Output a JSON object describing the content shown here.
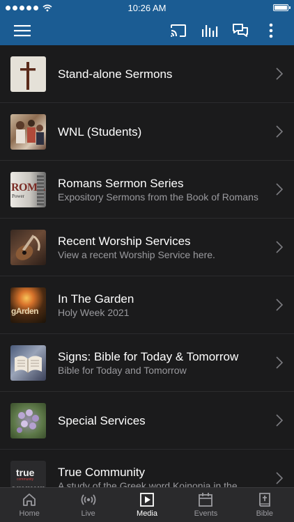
{
  "status_bar": {
    "time": "10:26 AM"
  },
  "app_bar": {
    "icons": [
      "menu-icon",
      "cast-icon",
      "audio-bars-icon",
      "chat-icon",
      "more-vertical-icon"
    ]
  },
  "items": [
    {
      "title": "Stand-alone Sermons",
      "subtitle": "",
      "thumb_icon": "cross-thumbnail"
    },
    {
      "title": "WNL (Students)",
      "subtitle": "",
      "thumb_icon": "students-photo-thumbnail"
    },
    {
      "title": "Romans Sermon Series",
      "subtitle": "Expository Sermons from the Book of Romans",
      "thumb_icon": "romans-thumbnail"
    },
    {
      "title": "Recent Worship Services",
      "subtitle": "View a recent Worship Service here.",
      "thumb_icon": "guitar-thumbnail"
    },
    {
      "title": "In The Garden",
      "subtitle": "Holy Week 2021",
      "thumb_icon": "garden-thumbnail",
      "thumb_text": "gArden"
    },
    {
      "title": "Signs: Bible for Today & Tomorrow",
      "subtitle": "Bible for Today and Tomorrow",
      "thumb_icon": "bible-thumbnail"
    },
    {
      "title": "Special Services",
      "subtitle": "",
      "thumb_icon": "flowers-thumbnail"
    },
    {
      "title": "True Community",
      "subtitle": "A study of the Greek word Koinonia in the",
      "thumb_icon": "true-community-thumbnail",
      "thumb_text": "true"
    }
  ],
  "thumb_texts": {
    "romans_big": "ROMA",
    "romans_small": "Power",
    "community_small": "community",
    "community_bottom": "ommuni"
  },
  "tabs": [
    {
      "label": "Home",
      "icon": "home-icon",
      "active": false
    },
    {
      "label": "Live",
      "icon": "live-broadcast-icon",
      "active": false
    },
    {
      "label": "Media",
      "icon": "media-play-icon",
      "active": true
    },
    {
      "label": "Events",
      "icon": "calendar-icon",
      "active": false
    },
    {
      "label": "Bible",
      "icon": "bible-icon",
      "active": false
    }
  ],
  "colors": {
    "app_bar": "#1b5c93",
    "background": "#1b1b1c",
    "tab_bar": "#2a2a2c",
    "active_tab": "#ffffff",
    "inactive_tab": "#9b9ba0"
  }
}
